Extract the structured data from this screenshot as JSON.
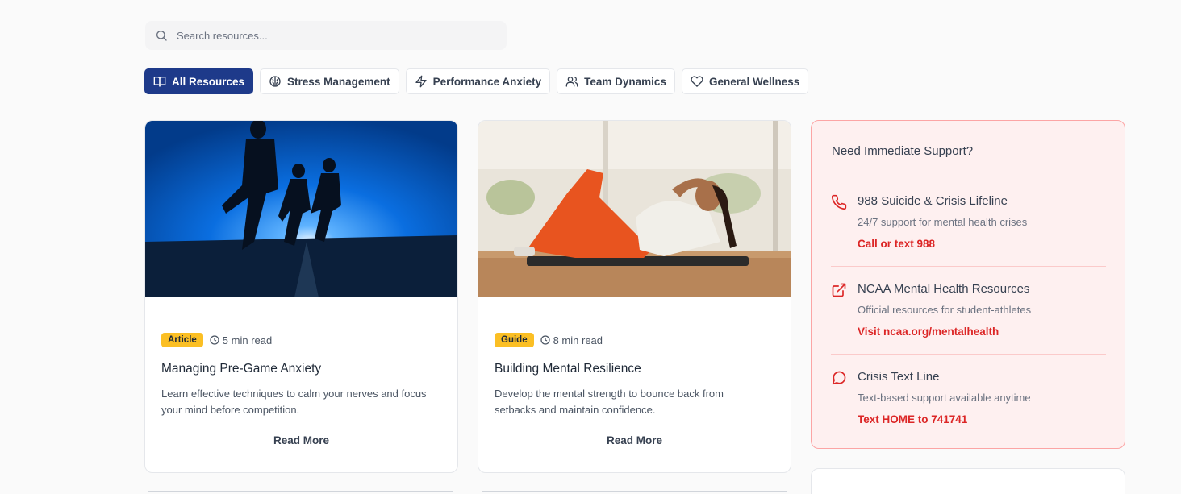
{
  "search": {
    "placeholder": "Search resources...",
    "value": ""
  },
  "filters": [
    {
      "label": "All Resources",
      "icon": "book-open-icon",
      "active": true
    },
    {
      "label": "Stress Management",
      "icon": "brain-icon",
      "active": false
    },
    {
      "label": "Performance Anxiety",
      "icon": "zap-icon",
      "active": false
    },
    {
      "label": "Team Dynamics",
      "icon": "users-icon",
      "active": false
    },
    {
      "label": "General Wellness",
      "icon": "heart-icon",
      "active": false
    }
  ],
  "cards": [
    {
      "badge": "Article",
      "read_time": "5 min read",
      "title": "Managing Pre-Game Anxiety",
      "description": "Learn effective techniques to calm your nerves and focus your mind before competition.",
      "cta": "Read More"
    },
    {
      "badge": "Guide",
      "read_time": "8 min read",
      "title": "Building Mental Resilience",
      "description": "Develop the mental strength to bounce back from setbacks and maintain confidence.",
      "cta": "Read More"
    }
  ],
  "support": {
    "title": "Need Immediate Support?",
    "items": [
      {
        "icon": "phone-icon",
        "name": "988 Suicide & Crisis Lifeline",
        "description": "24/7 support for mental health crises",
        "link": "Call or text 988"
      },
      {
        "icon": "external-link-icon",
        "name": "NCAA Mental Health Resources",
        "description": "Official resources for student-athletes",
        "link": "Visit ncaa.org/mentalhealth"
      },
      {
        "icon": "message-circle-icon",
        "name": "Crisis Text Line",
        "description": "Text-based support available anytime",
        "link": "Text HOME to 741741"
      }
    ]
  },
  "colors": {
    "primary": "#1e3a8a",
    "badge": "#fbbf24",
    "alert": "#dc2626",
    "alert_bg": "#fef0f0"
  }
}
